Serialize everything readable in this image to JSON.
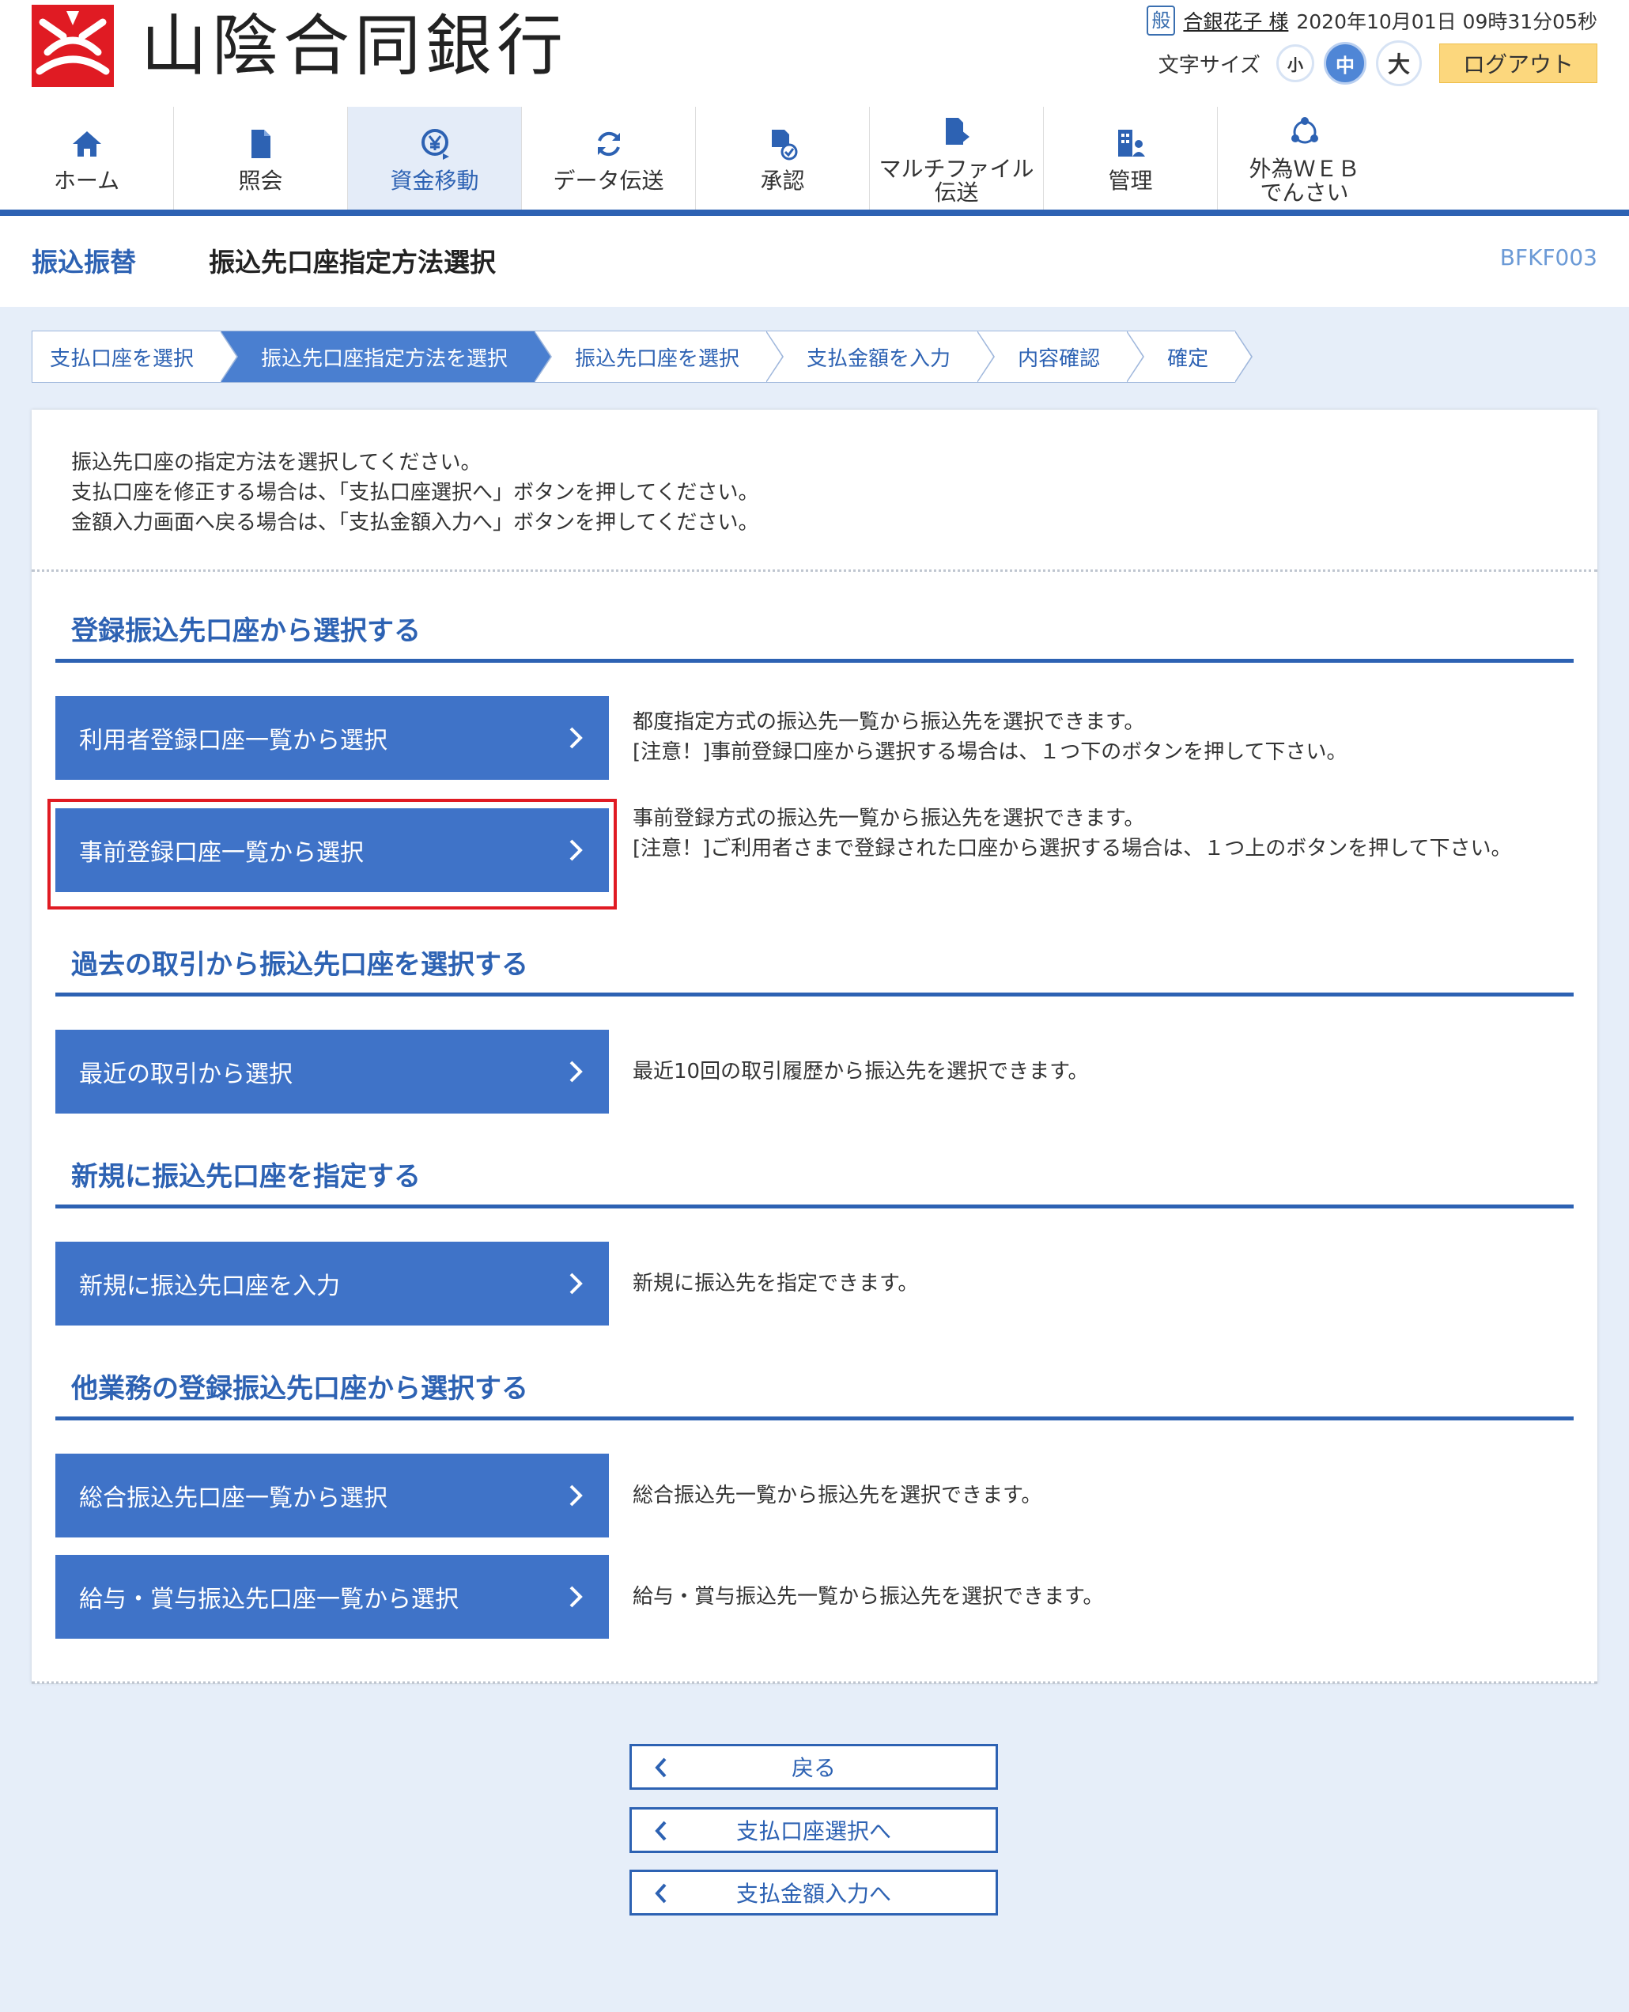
{
  "header": {
    "bank_name": "山陰合同銀行",
    "user_badge": "般",
    "user_name": "合銀花子 様",
    "datetime": "2020年10月01日 09時31分05秒",
    "font_size_label": "文字サイズ",
    "font_small": "小",
    "font_medium": "中",
    "font_large": "大",
    "logout_label": "ログアウト"
  },
  "nav": {
    "items": [
      {
        "label": "ホーム",
        "icon": "home-icon"
      },
      {
        "label": "照会",
        "icon": "document-icon"
      },
      {
        "label": "資金移動",
        "icon": "yen-transfer-icon"
      },
      {
        "label": "データ伝送",
        "icon": "refresh-icon"
      },
      {
        "label": "承認",
        "icon": "approve-icon"
      },
      {
        "label": "マルチファイル\n伝送",
        "icon": "file-upload-icon"
      },
      {
        "label": "管理",
        "icon": "manage-icon"
      },
      {
        "label": "外為ＷＥＢ\nでんさい",
        "icon": "network-icon"
      }
    ],
    "active_index": 2
  },
  "title_bar": {
    "section": "振込振替",
    "title": "振込先口座指定方法選択",
    "screen_code": "BFKF003"
  },
  "steps": [
    "支払口座を選択",
    "振込先口座指定方法を選択",
    "振込先口座を選択",
    "支払金額を入力",
    "内容確認",
    "確定"
  ],
  "current_step": 1,
  "intro": {
    "line1": "振込先口座の指定方法を選択してください。",
    "line2": "支払口座を修正する場合は、「支払口座選択へ」ボタンを押してください。",
    "line3": "金額入力画面へ戻る場合は、「支払金額入力へ」ボタンを押してください。"
  },
  "sections": {
    "registered": {
      "heading": "登録振込先口座から選択する",
      "btn1": "利用者登録口座一覧から選択",
      "desc1_line1": "都度指定方式の振込先一覧から振込先を選択できます。",
      "desc1_line2": "[注意！]事前登録口座から選択する場合は、１つ下のボタンを押して下さい。",
      "btn2": "事前登録口座一覧から選択",
      "desc2_line1": "事前登録方式の振込先一覧から振込先を選択できます。",
      "desc2_line2": "[注意！]ご利用者さまで登録された口座から選択する場合は、１つ上のボタンを押して下さい。"
    },
    "history": {
      "heading": "過去の取引から振込先口座を選択する",
      "btn": "最近の取引から選択",
      "desc": "最近10回の取引履歴から振込先を選択できます。"
    },
    "new": {
      "heading": "新規に振込先口座を指定する",
      "btn": "新規に振込先口座を入力",
      "desc": "新規に振込先を指定できます。"
    },
    "other": {
      "heading": "他業務の登録振込先口座から選択する",
      "btn1": "総合振込先口座一覧から選択",
      "desc1": "総合振込先一覧から振込先を選択できます。",
      "btn2": "給与・賞与振込先口座一覧から選択",
      "desc2": "給与・賞与振込先一覧から振込先を選択できます。"
    }
  },
  "footer_buttons": {
    "back": "戻る",
    "to_payment_account": "支払口座選択へ",
    "to_amount_input": "支払金額入力へ"
  },
  "colors": {
    "primary": "#2d62b3",
    "button": "#3f73c8",
    "background": "#e6eef9",
    "logout": "#fcd77d",
    "highlight": "#e01b23",
    "logo_red": "#e01b23"
  }
}
